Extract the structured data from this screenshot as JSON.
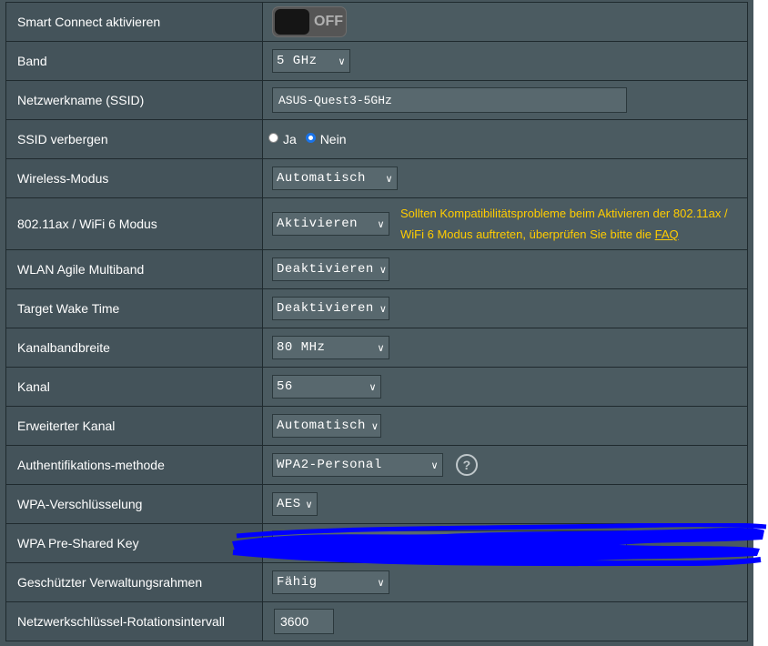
{
  "rows": [
    {
      "label": "Smart Connect aktivieren",
      "toggle_text": "OFF"
    },
    {
      "label": "Band",
      "value": "5 GHz"
    },
    {
      "label": "Netzwerkname (SSID)",
      "value": "ASUS-Quest3-5GHz"
    },
    {
      "label": "SSID verbergen",
      "opt1": "Ja",
      "opt2": "Nein",
      "selected": "Nein"
    },
    {
      "label": "Wireless-Modus",
      "value": "Automatisch"
    },
    {
      "label": "802.11ax / WiFi 6 Modus",
      "value": "Aktivieren",
      "note": "Sollten Kompatibilitätsprobleme beim Aktivieren der 802.11ax / WiFi 6 Modus auftreten, überprüfen Sie bitte die ",
      "link": "FAQ"
    },
    {
      "label": "WLAN Agile Multiband",
      "value": "Deaktivieren"
    },
    {
      "label": "Target Wake Time",
      "value": "Deaktivieren"
    },
    {
      "label": "Kanalbandbreite",
      "value": "80 MHz"
    },
    {
      "label": "Kanal",
      "value": "56"
    },
    {
      "label": "Erweiterter Kanal",
      "value": "Automatisch"
    },
    {
      "label": "Authentifikations-methode",
      "value": "WPA2-Personal"
    },
    {
      "label": "WPA-Verschlüsselung",
      "value": "AES"
    },
    {
      "label": "WPA Pre-Shared Key",
      "value": ""
    },
    {
      "label": "Geschützter Verwaltungsrahmen",
      "value": "Fähig"
    },
    {
      "label": "Netzwerkschlüssel-Rotationsintervall",
      "value": "3600"
    }
  ],
  "colors": {
    "panel": "#47565c",
    "note_text": "#ffcc00",
    "redaction": "#0000ff",
    "radio_selected": "#1a73e8"
  }
}
